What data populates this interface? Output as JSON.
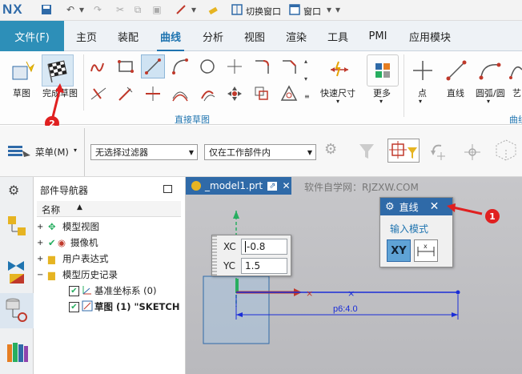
{
  "app": {
    "logo": "NX"
  },
  "quick_access": {
    "switch_window": "切换窗口",
    "window_menu": "窗口"
  },
  "tabs": [
    {
      "label": "文件(F)"
    },
    {
      "label": "主页"
    },
    {
      "label": "装配"
    },
    {
      "label": "曲线"
    },
    {
      "label": "分析"
    },
    {
      "label": "视图"
    },
    {
      "label": "渲染"
    },
    {
      "label": "工具"
    },
    {
      "label": "PMI"
    },
    {
      "label": "应用模块"
    }
  ],
  "ribbon": {
    "sketch": "草图",
    "finish_sketch": "完成草图",
    "group_direct_sketch": "直接草图",
    "quick_dimension": "快速尺寸",
    "more": "更多",
    "point": "点",
    "line": "直线",
    "arc_circle": "圆弧/圆",
    "art_spline": "艺",
    "curve_group": "曲线"
  },
  "toolbar": {
    "menu": "菜单(M)",
    "filter": "无选择过滤器",
    "scope": "仅在工作部件内"
  },
  "navigator": {
    "title": "部件导航器",
    "column_name": "名称",
    "items": [
      {
        "label": "模型视图"
      },
      {
        "label": "摄像机"
      },
      {
        "label": "用户表达式"
      },
      {
        "label": "模型历史记录"
      },
      {
        "label": "基准坐标系 (0)"
      },
      {
        "label": "草图 (1) \"SKETCH"
      }
    ]
  },
  "viewport": {
    "file_tab": "_model1.prt",
    "watermark": "软件自学网：RJZXW.COM",
    "dimension_label": "p6:4.0"
  },
  "coord_input": {
    "xc_label": "XC",
    "xc_value": "-0.8",
    "yc_label": "YC",
    "yc_value": "1.5"
  },
  "line_dialog": {
    "title": "直线",
    "input_mode_label": "输入模式",
    "mode_xy": "XY"
  },
  "annotations": {
    "marker1": "1",
    "marker2": "2"
  }
}
